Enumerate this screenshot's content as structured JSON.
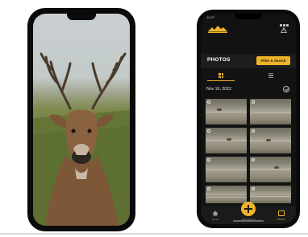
{
  "left_phone": {
    "screen_content": "deer-photo"
  },
  "right_phone": {
    "status": {
      "time": "12:47"
    },
    "header": {
      "logo": "brand-logo",
      "alert_icon": "warning-icon"
    },
    "photos_bar": {
      "title": "PHOTOS",
      "filter_button_label": "Filter & Search"
    },
    "view_tabs": {
      "active": "grid"
    },
    "date_group": {
      "label": "Nov 16, 2022"
    },
    "thumbnail_count": 8,
    "bottom_nav": {
      "home_label": "Home",
      "add_label": "Add Camera",
      "photos_label": "Photos"
    },
    "colors": {
      "accent": "#f0b229",
      "background": "#121212",
      "bar": "#1d1d1d"
    }
  }
}
